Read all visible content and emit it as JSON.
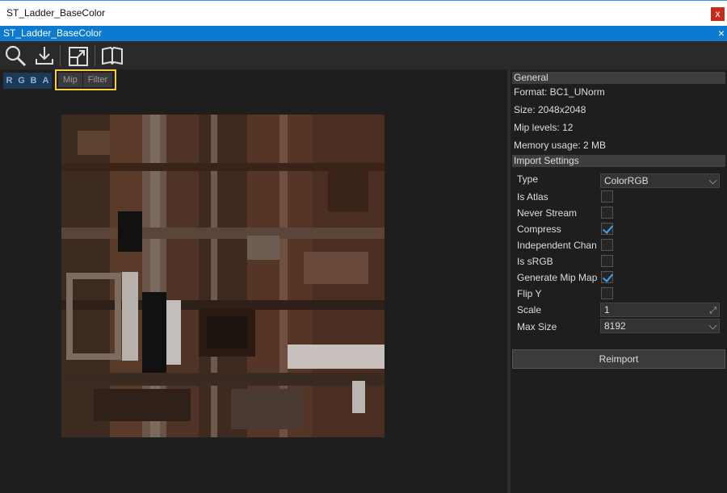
{
  "window": {
    "title": "ST_Ladder_BaseColor",
    "close_glyph": "x"
  },
  "tab": {
    "title": "ST_Ladder_BaseColor",
    "close_glyph": "×"
  },
  "toolbar": {
    "buttons": [
      {
        "name": "search-icon"
      },
      {
        "name": "download-icon"
      },
      {
        "name": "fit-view-icon"
      },
      {
        "name": "book-icon"
      }
    ]
  },
  "viewport": {
    "channels": [
      "R",
      "G",
      "B",
      "A"
    ],
    "mip_label": "Mip",
    "filter_label": "Filter"
  },
  "general": {
    "header": "General",
    "format": "Format: BC1_UNorm",
    "size": "Size: 2048x2048",
    "mip_levels": "Mip levels: 12",
    "memory": "Memory usage: 2 MB"
  },
  "import": {
    "header": "Import Settings",
    "type_label": "Type",
    "type_value": "ColorRGB",
    "is_atlas_label": "Is Atlas",
    "is_atlas": false,
    "never_stream_label": "Never Stream",
    "never_stream": false,
    "compress_label": "Compress",
    "compress": true,
    "independent_label": "Independent Chan",
    "independent": false,
    "is_srgb_label": "Is sRGB",
    "is_srgb": false,
    "gen_mips_label": "Generate Mip Maps",
    "gen_mips": true,
    "flip_y_label": "Flip Y",
    "flip_y": false,
    "scale_label": "Scale",
    "scale_value": "1",
    "max_size_label": "Max Size",
    "max_size_value": "8192",
    "reimport_label": "Reimport"
  },
  "colors": {
    "accent": "#0b7ad0",
    "highlight": "#f4d03f",
    "check": "#3da2f2"
  }
}
